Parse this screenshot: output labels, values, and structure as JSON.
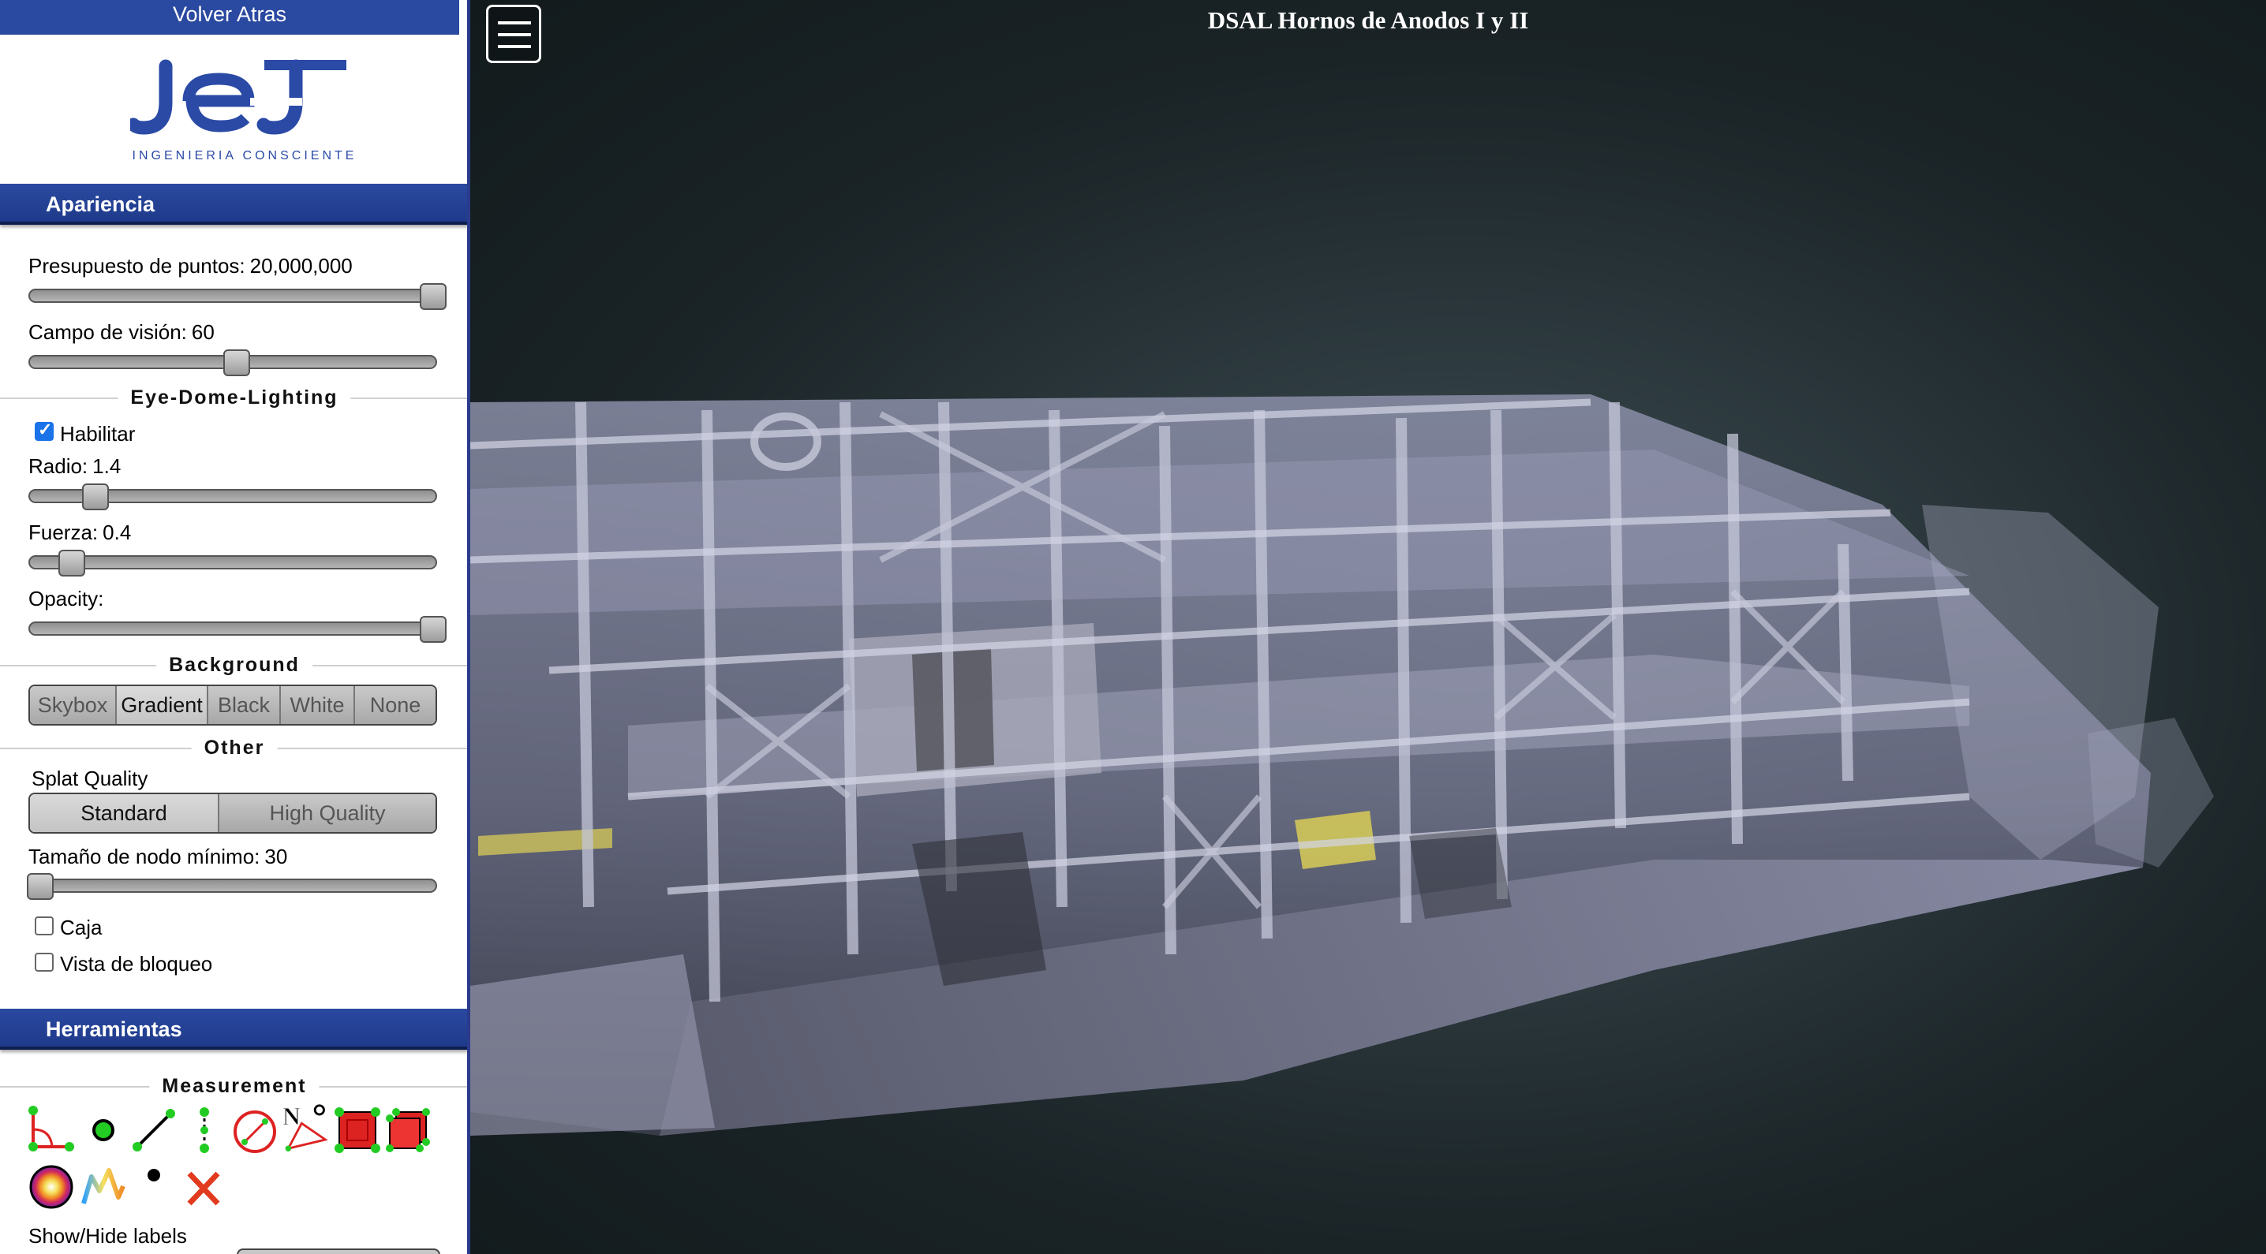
{
  "sidebar": {
    "back_label": "Volver Atras",
    "logo_tagline": "INGENIERIA CONSCIENTE",
    "appearance": {
      "header": "Apariencia",
      "point_budget": {
        "label": "Presupuesto de puntos:",
        "value": "20,000,000",
        "level": 1.0
      },
      "fov": {
        "label": "Campo de visión:",
        "value": "60",
        "level": 0.5
      },
      "edl": {
        "title": "Eye-Dome-Lighting",
        "enable_label": "Habilitar",
        "enabled": true,
        "radius": {
          "label": "Radio:",
          "value": "1.4",
          "level": 0.14
        },
        "strength": {
          "label": "Fuerza:",
          "value": "0.4",
          "level": 0.08
        },
        "opacity": {
          "label": "Opacity:",
          "level": 1.0
        }
      },
      "background": {
        "title": "Background",
        "options": [
          "Skybox",
          "Gradient",
          "Black",
          "White",
          "None"
        ],
        "selected": "Gradient"
      },
      "other": {
        "title": "Other",
        "splat_label": "Splat Quality",
        "splat_options": [
          "Standard",
          "High Quality"
        ],
        "splat_selected": "Standard",
        "min_node": {
          "label": "Tamaño de nodo mínimo:",
          "value": "30",
          "level": 0.0
        },
        "box_label": "Caja",
        "box_checked": false,
        "lock_label": "Vista de bloqueo",
        "lock_checked": false
      }
    },
    "tools": {
      "header": "Herramientas",
      "measurement_title": "Measurement",
      "icons": [
        "angle-icon",
        "point-icon",
        "distance-icon",
        "height-icon",
        "circle-icon",
        "azimuth-icon",
        "area-icon",
        "volume-icon",
        "sphere-volume-icon",
        "height-profile-icon",
        "annotation-icon",
        "remove-all-icon"
      ],
      "labels_toggle": "Show/Hide labels"
    }
  },
  "viewer": {
    "title": "DSAL Hornos de Anodos I y II",
    "menu_icon": "hamburger-icon"
  },
  "colors": {
    "accent": "#2a49a0",
    "background": "#1a2326"
  }
}
